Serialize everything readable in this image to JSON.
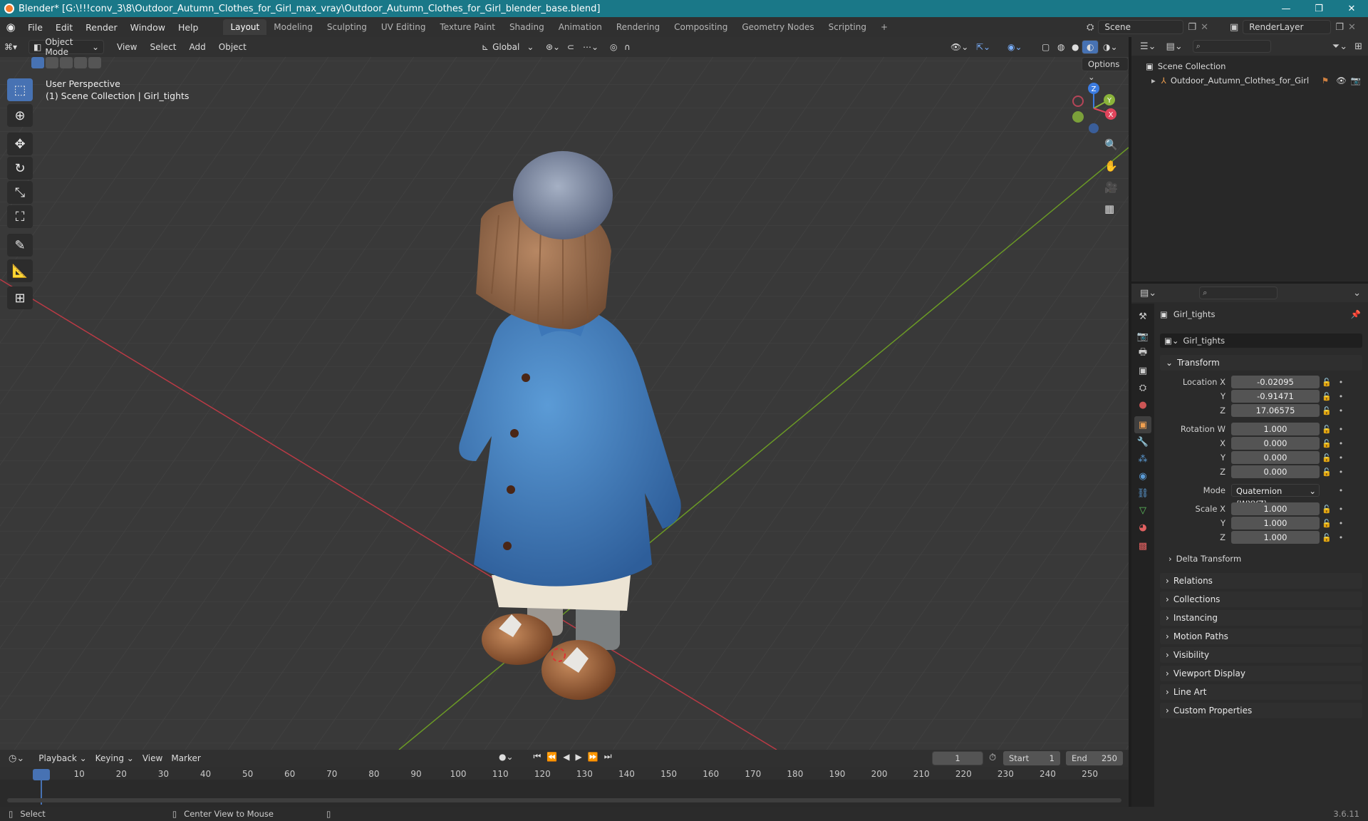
{
  "window": {
    "title": "Blender* [G:\\!!!conv_3\\8\\Outdoor_Autumn_Clothes_for_Girl_max_vray\\Outdoor_Autumn_Clothes_for_Girl_blender_base.blend]",
    "minimize": "—",
    "maximize": "❐",
    "close": "✕"
  },
  "menus": [
    "File",
    "Edit",
    "Render",
    "Window",
    "Help"
  ],
  "workspaces": [
    "Layout",
    "Modeling",
    "Sculpting",
    "UV Editing",
    "Texture Paint",
    "Shading",
    "Animation",
    "Rendering",
    "Compositing",
    "Geometry Nodes",
    "Scripting",
    "+"
  ],
  "scene": {
    "name": "Scene",
    "render_layer": "RenderLayer"
  },
  "viewport": {
    "mode": "Object Mode",
    "menus": [
      "View",
      "Select",
      "Add",
      "Object"
    ],
    "orientation": "Global",
    "options": "Options",
    "overlay_line1": "User Perspective",
    "overlay_line2": "(1) Scene Collection | Girl_tights",
    "gizmo": {
      "z": "Z",
      "y": "Y",
      "x": "X"
    }
  },
  "outliner": {
    "root": "Scene Collection",
    "items": [
      "Outdoor_Autumn_Clothes_for_Girl"
    ]
  },
  "properties": {
    "object_name": "Girl_tights",
    "data_name": "Girl_tights",
    "transform_title": "Transform",
    "location": {
      "label": "Location X",
      "x": "-0.02095",
      "y": "-0.91471",
      "z": "17.06575"
    },
    "rotation": {
      "label": "Rotation W",
      "w": "1.000",
      "x": "0.000",
      "y": "0.000",
      "z": "0.000"
    },
    "mode_label": "Mode",
    "mode_value": "Quaternion (WXYZ)",
    "scale": {
      "label": "Scale X",
      "x": "1.000",
      "y": "1.000",
      "z": "1.000"
    },
    "axis_labels": {
      "y": "Y",
      "z": "Z",
      "x": "X"
    },
    "delta": "Delta Transform",
    "panels": [
      "Relations",
      "Collections",
      "Instancing",
      "Motion Paths",
      "Visibility",
      "Viewport Display",
      "Line Art",
      "Custom Properties"
    ]
  },
  "timeline": {
    "menus": [
      "Playback",
      "Keying",
      "View",
      "Marker"
    ],
    "current_frame": "1",
    "start_label": "Start",
    "start": "1",
    "end_label": "End",
    "end": "250",
    "ticks": [
      "1",
      "10",
      "20",
      "30",
      "40",
      "50",
      "60",
      "70",
      "80",
      "90",
      "100",
      "110",
      "120",
      "130",
      "140",
      "150",
      "160",
      "170",
      "180",
      "190",
      "200",
      "210",
      "220",
      "230",
      "240",
      "250"
    ]
  },
  "status": {
    "select": "Select",
    "center_view": "Center View to Mouse",
    "version": "3.6.11"
  },
  "colors": {
    "accent": "#4772b3",
    "titlebar": "#1a7888",
    "x_axis": "#ba3a45",
    "y_axis": "#6b9a25"
  }
}
